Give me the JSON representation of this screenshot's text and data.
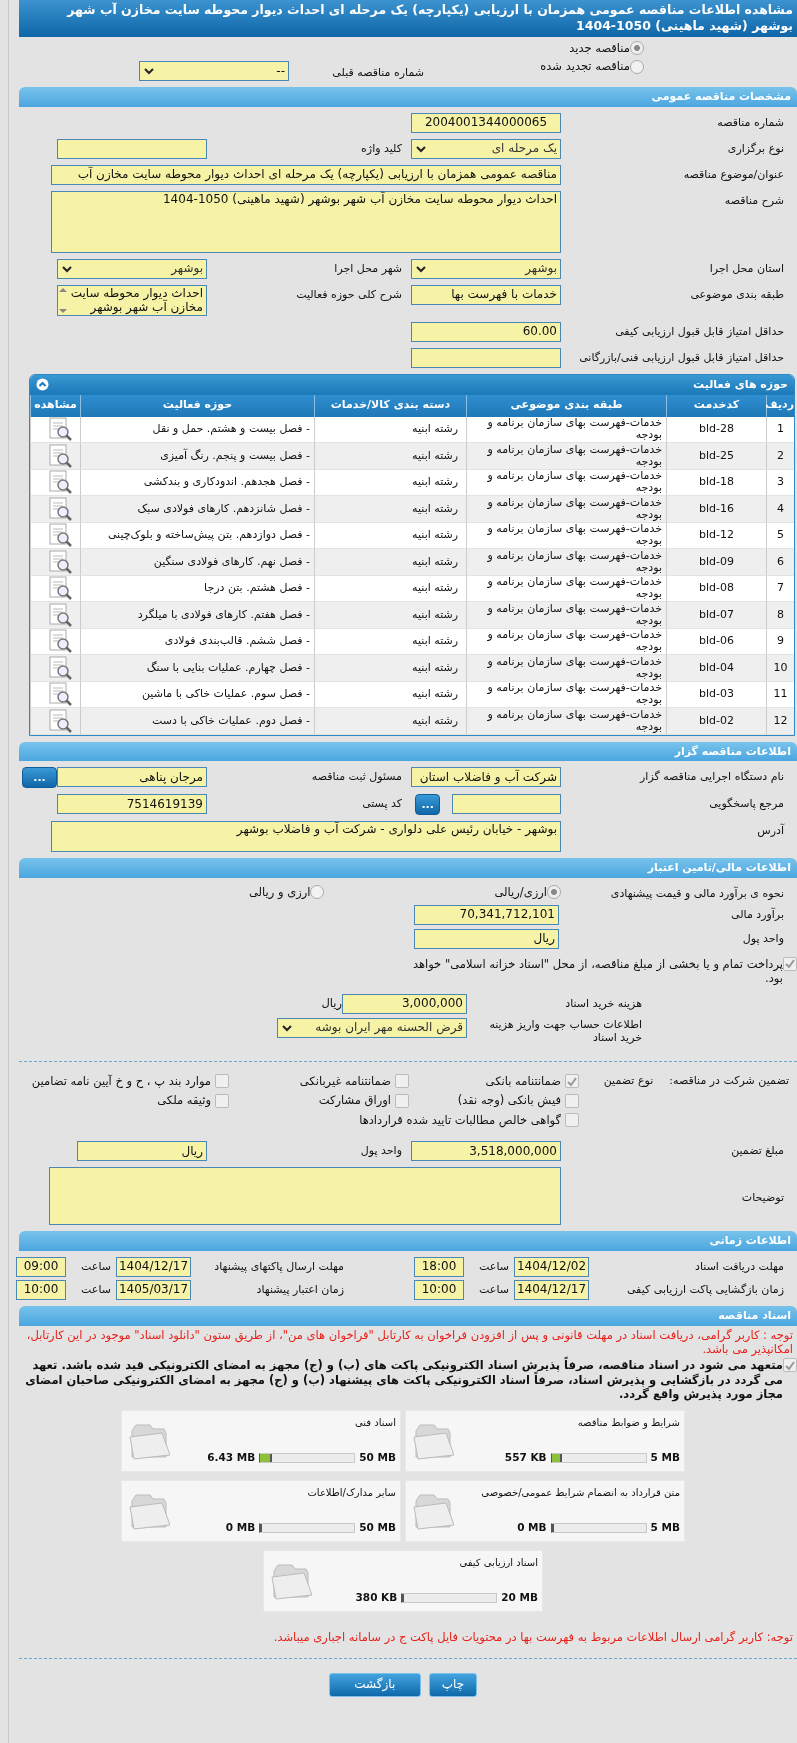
{
  "title": "مشاهده اطلاعات مناقصه عمومی همزمان با ارزیابی (یکپارچه) یک مرحله ای احداث دیوار محوطه سایت مخازن آب شهر بوشهر (شهید ماهینی) 1050-1404",
  "tender_type": [
    {
      "label": "مناقصه جدید",
      "selected": true
    },
    {
      "label": "مناقصه تجدید شده",
      "selected": false
    }
  ],
  "previous_tender": {
    "label": "شماره مناقصه قبلی",
    "value": "--"
  },
  "general": {
    "heading": "مشخصات مناقصه عمومی",
    "rows": [
      [
        {
          "label": "شماره مناقصه",
          "value": "2004001344000065",
          "kind": "center"
        }
      ],
      [
        {
          "label": "نوع برگزاری",
          "value": "یک مرحله ای",
          "kind": "select"
        },
        {
          "label": "کلید واژه",
          "kind": "text"
        }
      ],
      [
        {
          "label": "عنوان/موضوع مناقصه",
          "value": "مناقصه عمومی همزمان با ارزیابی (یکپارچه) یک مرحله ای احداث دیوار محوطه سایت مخازن آب",
          "kind": "long"
        }
      ],
      [
        {
          "label": "شرح مناقصه",
          "value": "احداث دیوار محوطه سایت مخازن آب شهر بوشهر (شهید ماهینی) 1050-1404",
          "kind": "area"
        }
      ],
      [
        {
          "label": "استان محل اجرا",
          "value": "بوشهر",
          "kind": "select"
        },
        {
          "label": "شهر محل اجرا",
          "value": "بوشهر",
          "kind": "select"
        }
      ],
      [
        {
          "label": "طبقه بندی موضوعی",
          "value": "خدمات با فهرست بها",
          "kind": "text"
        },
        {
          "label": "شرح کلی حوزه فعالیت",
          "value": "احداث دیوار محوطه سایت مخازن آب شهر بوشهر",
          "kind": "list"
        }
      ],
      [
        {
          "label": "حداقل امتیاز قابل قبول ارزیابی کیفی",
          "value": "60.00",
          "kind": "number"
        }
      ],
      [
        {
          "label": "حداقل امتیاز قابل قبول ارزیابی فنی/بازرگانی",
          "kind": "number"
        }
      ]
    ]
  },
  "activities": {
    "heading": "حوزه های فعالیت",
    "columns": [
      "ردیف",
      "کدخدمت",
      "طبقه بندی موضوعی",
      "دسته بندی کالا/خدمات",
      "حوزه فعالیت",
      "مشاهده"
    ],
    "rows": [
      [
        "1",
        "bld-28",
        "خدمات-فهرست بهای سازمان برنامه و بودجه",
        "رشته ابنیه",
        "- فصل بیست و هشتم. حمل و نقل"
      ],
      [
        "2",
        "bld-25",
        "خدمات-فهرست بهای سازمان برنامه و بودجه",
        "رشته ابنیه",
        "- فصل بیست و پنجم. رنگ آمیزی"
      ],
      [
        "3",
        "bld-18",
        "خدمات-فهرست بهای سازمان برنامه و بودجه",
        "رشته ابنیه",
        "- فصل هجدهم. اندودکاری و بندکشی"
      ],
      [
        "4",
        "bld-16",
        "خدمات-فهرست بهای سازمان برنامه و بودجه",
        "رشته ابنیه",
        "- فصل شانزدهم. کارهای فولادی سبک"
      ],
      [
        "5",
        "bld-12",
        "خدمات-فهرست بهای سازمان برنامه و بودجه",
        "رشته ابنیه",
        "- فصل دوازدهم. بتن پیش‌ساخته و بلوک‌چینی"
      ],
      [
        "6",
        "bld-09",
        "خدمات-فهرست بهای سازمان برنامه و بودجه",
        "رشته ابنیه",
        "- فصل نهم. کارهای فولادی سنگین"
      ],
      [
        "7",
        "bld-08",
        "خدمات-فهرست بهای سازمان برنامه و بودجه",
        "رشته ابنیه",
        "- فصل هشتم. بتن درجا"
      ],
      [
        "8",
        "bld-07",
        "خدمات-فهرست بهای سازمان برنامه و بودجه",
        "رشته ابنیه",
        "- فصل هفتم. کارهای فولادی با میلگرد"
      ],
      [
        "9",
        "bld-06",
        "خدمات-فهرست بهای سازمان برنامه و بودجه",
        "رشته ابنیه",
        "- فصل ششم. قالب‌بندی فولادی"
      ],
      [
        "10",
        "bld-04",
        "خدمات-فهرست بهای سازمان برنامه و بودجه",
        "رشته ابنیه",
        "- فصل چهارم. عملیات بنایی با سنگ"
      ],
      [
        "11",
        "bld-03",
        "خدمات-فهرست بهای سازمان برنامه و بودجه",
        "رشته ابنیه",
        "- فصل سوم. عملیات خاکی با ماشین"
      ],
      [
        "12",
        "bld-02",
        "خدمات-فهرست بهای سازمان برنامه و بودجه",
        "رشته ابنیه",
        "- فصل دوم. عملیات خاکی با دست"
      ]
    ]
  },
  "organizer": {
    "heading": "اطلاعات مناقصه گزار",
    "rows": [
      [
        {
          "label": "نام دستگاه اجرایی مناقصه گزار",
          "value": "شرکت آب و فاضلاب استان",
          "kind": "text"
        },
        {
          "label": "مسئول ثبت مناقصه",
          "value": "مرجان پناهی",
          "kind": "text",
          "button": "..."
        }
      ],
      [
        {
          "label": "مرجع پاسخگویی",
          "kind": "text",
          "button": "..."
        },
        {
          "label": "کد پستی",
          "value": "7514619139",
          "kind": "number"
        }
      ],
      [
        {
          "label": "آدرس",
          "value": "بوشهر - خیابان رئیس علی دلواری - شرکت آب و فاضلاب بوشهر",
          "kind": "address"
        }
      ]
    ]
  },
  "finance": {
    "heading": "اطلاعات مالی/تامین اعتبار",
    "method_label": "نحوه ی برآورد مالی و قیمت پیشنهادی",
    "methods": [
      {
        "label": "ارزی/ریالی",
        "selected": true
      },
      {
        "label": "ارزی و ریالی",
        "selected": false
      }
    ],
    "estimate": {
      "label": "برآورد مالی",
      "value": "70,341,712,101"
    },
    "currency": {
      "label": "واحد پول",
      "value": "ریال"
    },
    "treasury": {
      "label": "پرداخت تمام و یا بخشی از مبلغ مناقصه، از محل \"اسناد خزانه اسلامی\" خواهد بود.",
      "checked": true
    },
    "document_fee": {
      "label": "هزینه خرید اسناد",
      "value": "3,000,000",
      "unit": "ریال"
    },
    "account": {
      "label": "اطلاعات حساب جهت واریز هزینه خرید اسناد",
      "value": "قرض الحسنه مهر ایران بوشه"
    }
  },
  "guarantee": {
    "label": "تضمین شرکت در مناقصه:",
    "type_label": "نوع تضمین",
    "options": [
      {
        "label": "ضمانتنامه بانکی",
        "checked": true
      },
      {
        "label": "ضمانتنامه غیربانکی",
        "checked": false
      },
      {
        "label": "موارد بند پ ، ح و خ آیین نامه تضامین",
        "checked": false
      },
      {
        "label": "فیش بانکی (وجه نقد)",
        "checked": false
      },
      {
        "label": "اوراق مشارکت",
        "checked": false
      },
      {
        "label": "وثیقه ملکی",
        "checked": false
      },
      {
        "label": "گواهی خالص مطالبات تایید شده قراردادها",
        "checked": false
      }
    ],
    "amount": {
      "label": "مبلغ تضمین",
      "value": "3,518,000,000"
    },
    "currency": {
      "label": "واحد پول",
      "value": "ریال"
    },
    "notes": {
      "label": "توضیحات"
    }
  },
  "timing": {
    "heading": "اطلاعات زمانی",
    "rows": [
      [
        {
          "label": "مهلت دریافت اسناد",
          "date": "1404/12/02",
          "time_label": "ساعت",
          "time": "18:00"
        },
        {
          "label": "مهلت ارسال پاکتهای پیشنهاد",
          "date": "1404/12/17",
          "time_label": "ساعت",
          "time": "09:00"
        }
      ],
      [
        {
          "label": "زمان بازگشایی پاکت ارزیابی کیفی",
          "date": "1404/12/17",
          "time_label": "ساعت",
          "time": "10:00"
        },
        {
          "label": "زمان اعتبار پیشنهاد",
          "date": "1405/03/17",
          "time_label": "ساعت",
          "time": "10:00"
        }
      ]
    ]
  },
  "documents": {
    "heading": "اسناد مناقصه",
    "notice": "توجه : کاربر گرامی، دریافت اسناد در مهلت قانونی و پس از افزودن فراخوان به کارتابل \"فراخوان های من\"، از طریق ستون \"دانلود اسناد\" موجود در این کارتابل، امکانپذیر می باشد.",
    "commitment": {
      "label": "متعهد می شود در اسناد مناقصه، صرفاً پذیرش اسناد الکترونیکی پاکت های (ب) و (ج) مجهز به امضای الکترونیکی قید شده باشد. تعهد می گردد در بازگشایی و پذیرش اسناد، صرفاً اسناد الکترونیکی پاکت های پیشنهاد (ب) و (ج) مجهز به امضای الکترونیکی صاحبان امضای مجاز مورد پذیرش واقع گردد.",
      "checked": true
    },
    "files": [
      {
        "name": "شرایط و ضوابط مناقصه",
        "max": "5 MB",
        "used": "557 KB",
        "level": 0.11
      },
      {
        "name": "اسناد فنی",
        "max": "50 MB",
        "used": "6.43 MB",
        "level": 0.13
      },
      {
        "name": "متن قرارداد به انضمام شرایط عمومی/خصوصی",
        "max": "5 MB",
        "used": "0 MB",
        "level": 0
      },
      {
        "name": "سایر مدارک/اطلاعات",
        "max": "50 MB",
        "used": "0 MB",
        "level": 0
      },
      {
        "name": "اسناد ارزیابی کیفی",
        "max": "20 MB",
        "used": "380 KB",
        "level": 0.02
      }
    ],
    "footnote": "توجه: کاربر گرامی ارسال اطلاعات مربوط به فهرست بها در محتویات فایل پاکت ج در سامانه اجباری میباشد."
  },
  "buttons": [
    "چاپ",
    "بازگشت"
  ]
}
